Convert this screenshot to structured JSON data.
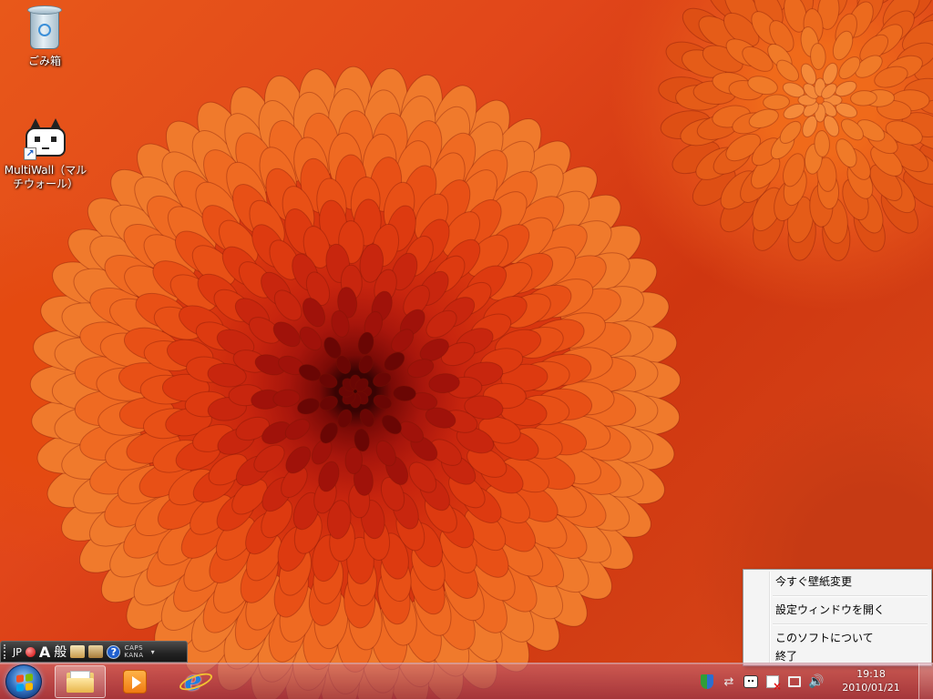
{
  "desktop": {
    "icons": [
      {
        "label": "ごみ箱",
        "icon": "recycle-bin-icon"
      },
      {
        "label": "MultiWall（マル チウォール）",
        "icon": "cat-face-icon"
      }
    ]
  },
  "language_bar": {
    "lang": "JP",
    "input_mode": "A",
    "kanji_mode": "般",
    "help": "?",
    "caps": "CAPS",
    "kana": "KANA"
  },
  "context_menu": {
    "items": [
      "今すぐ壁紙変更",
      "設定ウィンドウを開く",
      "このソフトについて",
      "終了"
    ]
  },
  "taskbar": {
    "pinned": [
      "windows-explorer-icon",
      "media-player-icon",
      "internet-explorer-icon"
    ],
    "clock": {
      "time": "19:18",
      "date": "2010/01/21"
    }
  },
  "colors": {
    "taskbar": "#b05068",
    "menu_bg": "#f4f4f4",
    "wallpaper_main": "#e1461a"
  }
}
